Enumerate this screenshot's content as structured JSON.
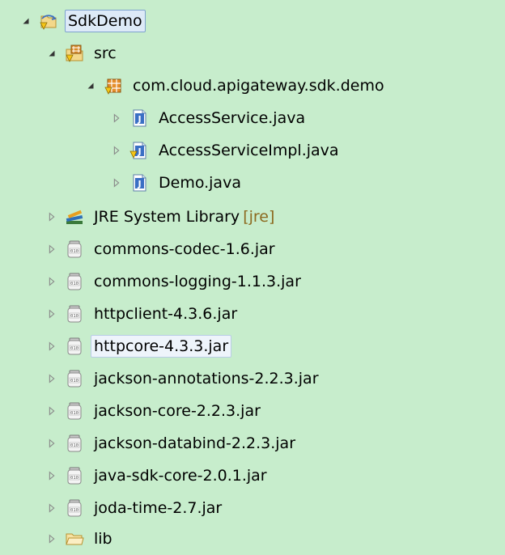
{
  "tree": {
    "project": {
      "label": "SdkDemo"
    },
    "src": {
      "label": "src"
    },
    "package": {
      "label": "com.cloud.apigateway.sdk.demo"
    },
    "files": [
      {
        "label": "AccessService.java"
      },
      {
        "label": "AccessServiceImpl.java"
      },
      {
        "label": "Demo.java"
      }
    ],
    "jre": {
      "label": "JRE System Library",
      "decoration": "[jre]"
    },
    "jars": [
      {
        "label": "commons-codec-1.6.jar"
      },
      {
        "label": "commons-logging-1.1.3.jar"
      },
      {
        "label": "httpclient-4.3.6.jar"
      },
      {
        "label": "httpcore-4.3.3.jar"
      },
      {
        "label": "jackson-annotations-2.2.3.jar"
      },
      {
        "label": "jackson-core-2.2.3.jar"
      },
      {
        "label": "jackson-databind-2.2.3.jar"
      },
      {
        "label": "java-sdk-core-2.0.1.jar"
      },
      {
        "label": "joda-time-2.7.jar"
      }
    ],
    "lib": {
      "label": "lib"
    }
  },
  "colors": {
    "background": "#c7edcc",
    "selection_border": "#7da2ce",
    "decoration": "#8c6a1f"
  },
  "icons": {
    "expanded": "triangle-down-icon",
    "collapsed": "triangle-right-icon",
    "project": "java-project-icon",
    "source_folder": "source-folder-icon",
    "package": "package-icon",
    "java_file": "java-file-icon",
    "library": "library-icon",
    "jar": "jar-icon",
    "folder": "folder-icon"
  }
}
